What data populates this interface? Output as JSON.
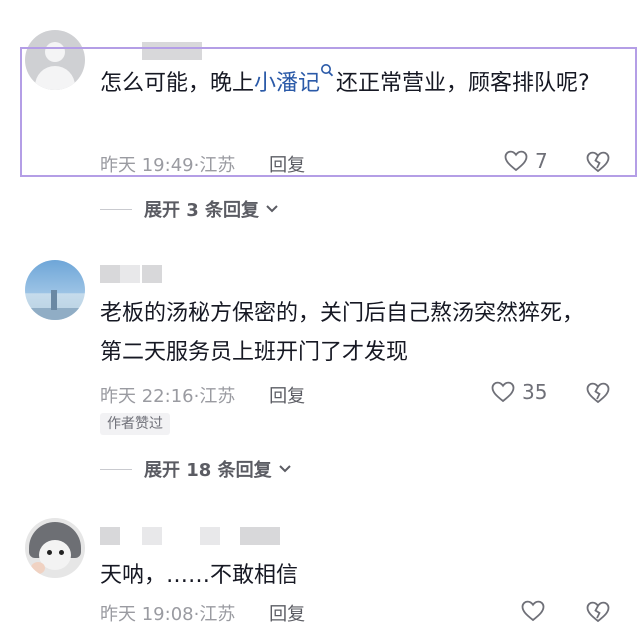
{
  "comments": [
    {
      "text_before": "怎么可能，晚上",
      "link": "小潘记",
      "text_after": "还正常营业，顾客排队呢?",
      "time": "昨天 19:49",
      "location": "江苏",
      "reply_label": "回复",
      "likes": "7",
      "avatar_icon": "default-user-icon",
      "expand_label": "展开 3 条回复"
    },
    {
      "text": "老板的汤秘方保密的，关门后自己熬汤突然猝死，第二天服务员上班开门了才发现",
      "time": "昨天 22:16",
      "location": "江苏",
      "reply_label": "回复",
      "likes": "35",
      "badge": "作者赞过",
      "expand_label": "展开 18 条回复"
    },
    {
      "text": "天呐，……不敢相信",
      "time": "昨天 19:08",
      "location": "江苏",
      "reply_label": "回复",
      "likes": ""
    }
  ],
  "colors": {
    "link": "#2b5aa8",
    "highlight_border": "#b49ee6",
    "meta": "#9a9ba1"
  }
}
